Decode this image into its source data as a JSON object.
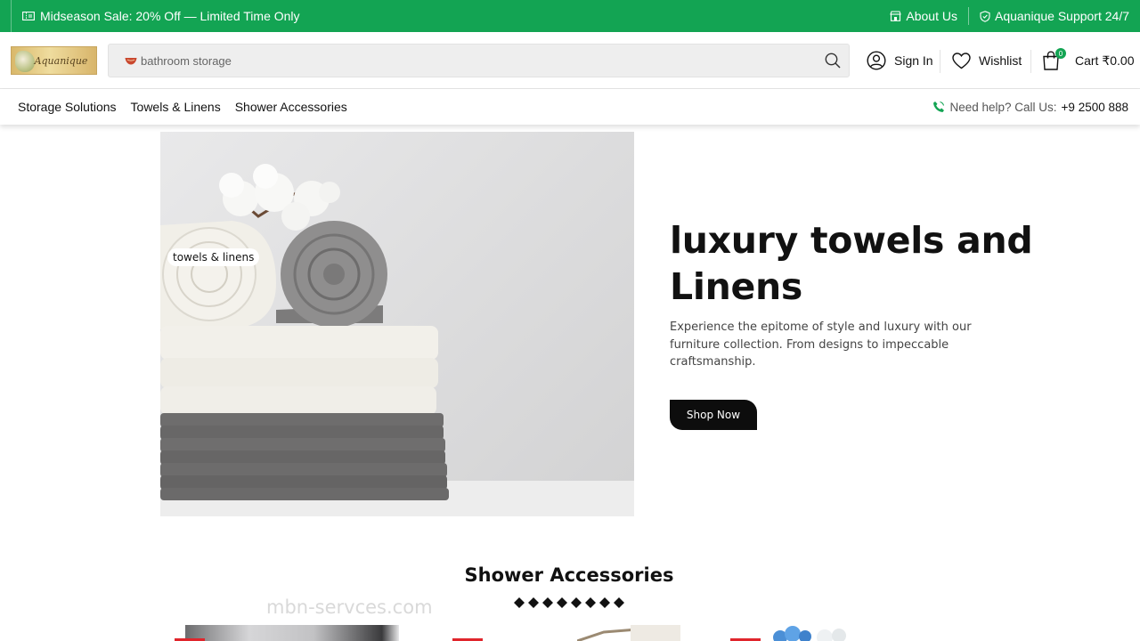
{
  "topbar": {
    "promo_text": "Midseason Sale: 20% Off — Limited Time Only",
    "about_label": "About Us",
    "support_label": "Aquanique Support 24/7",
    "bg_color": "#13a453"
  },
  "header": {
    "logo_text": "Aquanique",
    "search": {
      "value": "",
      "placeholder": "bathroom storage"
    },
    "sign_in_label": "Sign In",
    "wishlist_label": "Wishlist",
    "cart_label": "Cart ₹0.00",
    "cart_count": "0"
  },
  "nav": {
    "links": [
      "Storage Solutions",
      "Towels & Linens",
      "Shower Accessories"
    ],
    "help_text": "Need help? Call Us:",
    "help_phone": "+9 2500 888"
  },
  "hero": {
    "image_tag": "towels & linens",
    "title": "luxury towels and Linens",
    "description": "Experience the epitome of style and luxury with our furniture collection. From designs to impeccable craftsmanship.",
    "button_label": "Shop Now"
  },
  "section": {
    "title": "Shower Accessories",
    "watermark": "mbn-servces.com"
  },
  "icons": [
    "ticket-icon",
    "store-icon",
    "shield-icon",
    "bowl-icon",
    "search-icon",
    "user-icon",
    "heart-icon",
    "bag-icon",
    "phone-icon"
  ],
  "colors": {
    "accent": "#13a453",
    "button": "#0d0d0d",
    "sale": "#e0252c"
  }
}
